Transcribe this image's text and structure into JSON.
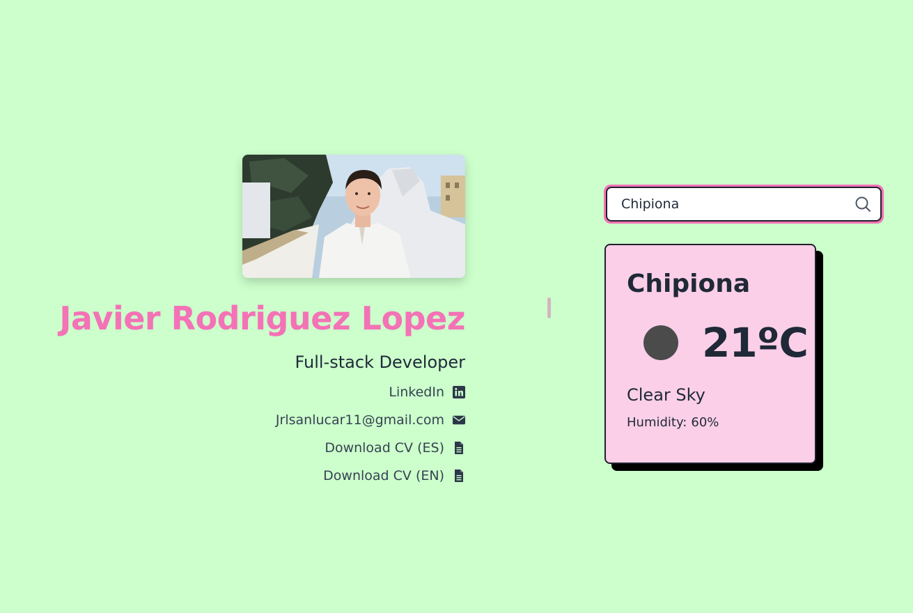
{
  "profile": {
    "photo_alt": "Profile photo",
    "name": "Javier Rodriguez Lopez",
    "role": "Full-stack Developer",
    "links": [
      {
        "label": "LinkedIn",
        "icon": "linkedin-icon"
      },
      {
        "label": "Jrlsanlucar11@gmail.com",
        "icon": "envelope-icon"
      },
      {
        "label": "Download CV (ES)",
        "icon": "file-icon"
      },
      {
        "label": "Download CV (EN)",
        "icon": "file-icon"
      }
    ]
  },
  "weather": {
    "search": {
      "value": "Chipiona",
      "icon": "search-icon"
    },
    "city": "Chipiona",
    "icon": "weather-status-icon",
    "temperature": "21ºC",
    "description": "Clear Sky",
    "humidity_label": "Humidity:",
    "humidity_value": "60%"
  },
  "colors": {
    "background": "#ccffcc",
    "accent_pink": "#f472b6",
    "card_bg": "#fbcfe8",
    "text_dark": "#1f2937"
  }
}
